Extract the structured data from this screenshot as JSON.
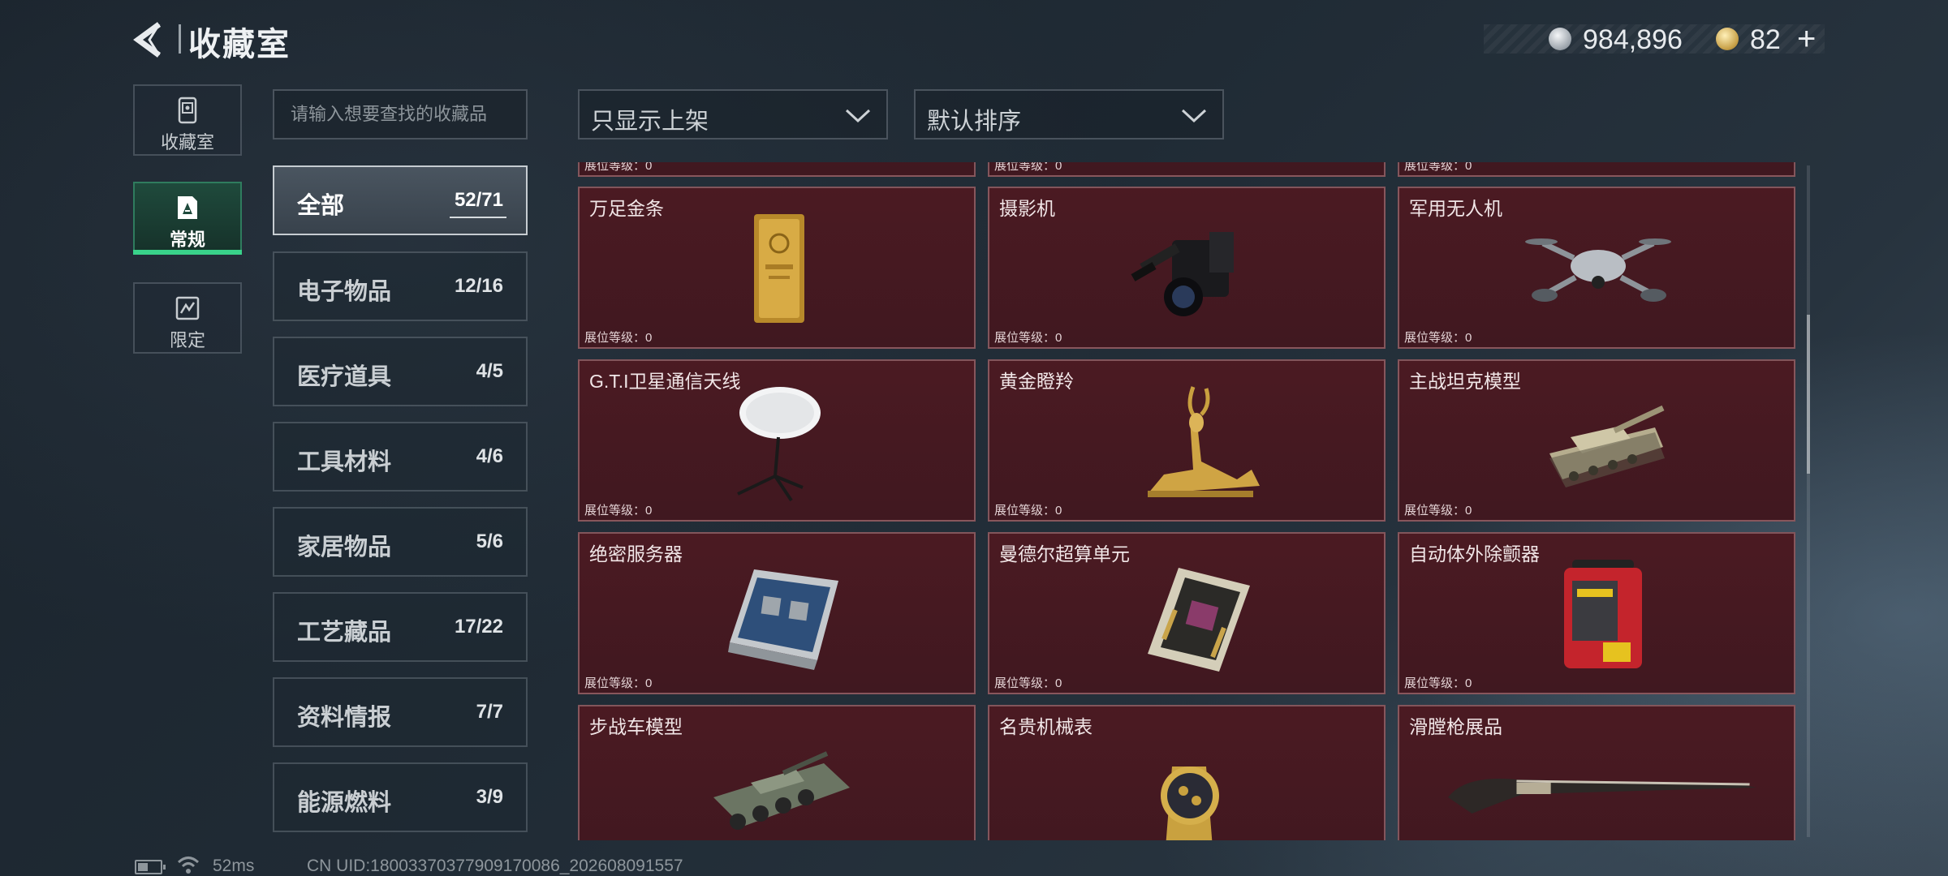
{
  "header": {
    "title": "收藏室",
    "currency_silver": "984,896",
    "currency_gold": "82",
    "add_symbol": "+"
  },
  "nav": {
    "items": [
      {
        "label": "收藏室",
        "icon": "collection-room-icon"
      },
      {
        "label": "常规",
        "icon": "regular-icon"
      },
      {
        "label": "限定",
        "icon": "limited-icon"
      }
    ],
    "active_index": 1
  },
  "search": {
    "placeholder": "请输入想要查找的收藏品",
    "value": ""
  },
  "filters": {
    "display": "只显示上架",
    "sort": "默认排序"
  },
  "categories": [
    {
      "name": "全部",
      "count": "52/71"
    },
    {
      "name": "电子物品",
      "count": "12/16"
    },
    {
      "name": "医疗道具",
      "count": "4/5"
    },
    {
      "name": "工具材料",
      "count": "4/6"
    },
    {
      "name": "家居物品",
      "count": "5/6"
    },
    {
      "name": "工艺藏品",
      "count": "17/22"
    },
    {
      "name": "资料情报",
      "count": "7/7"
    },
    {
      "name": "能源燃料",
      "count": "3/9"
    }
  ],
  "active_category": 0,
  "grid": {
    "level_label": "展位等级：0",
    "items": [
      {
        "name": "",
        "art": "partial"
      },
      {
        "name": "",
        "art": "partial"
      },
      {
        "name": "",
        "art": "partial"
      },
      {
        "name": "万足金条",
        "art": "gold-bar"
      },
      {
        "name": "摄影机",
        "art": "camera"
      },
      {
        "name": "军用无人机",
        "art": "drone"
      },
      {
        "name": "G.T.I卫星通信天线",
        "art": "satellite-dish"
      },
      {
        "name": "黄金瞪羚",
        "art": "gazelle"
      },
      {
        "name": "主战坦克模型",
        "art": "tank"
      },
      {
        "name": "绝密服务器",
        "art": "server"
      },
      {
        "name": "曼德尔超算单元",
        "art": "cpu"
      },
      {
        "name": "自动体外除颤器",
        "art": "defibrillator"
      },
      {
        "name": "步战车模型",
        "art": "ifv"
      },
      {
        "name": "名贵机械表",
        "art": "watch"
      },
      {
        "name": "滑膛枪展品",
        "art": "musket"
      }
    ]
  },
  "footer": {
    "ping": "52ms",
    "uid": "CN UID:18003370377909170086_202608091557"
  },
  "colors": {
    "accent_green": "#39d28a",
    "card_bg": "#4b1a22",
    "background": "#202b35"
  }
}
